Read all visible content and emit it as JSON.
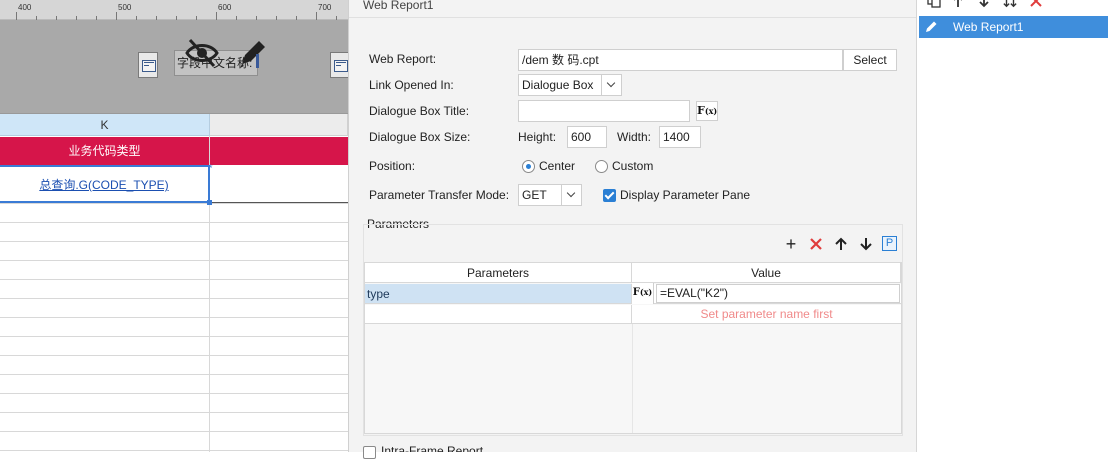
{
  "ruler": {
    "labels": [
      "400",
      "500",
      "600",
      "700"
    ]
  },
  "designer": {
    "field_label": "字段中文名称:",
    "column_header": "K",
    "header_cell": "业务代码类型",
    "selected_cell": "总查询.G(CODE_TYPE)"
  },
  "dialog": {
    "title": "Web Report1",
    "web_report_label": "Web Report:",
    "web_report_value": "/dem              数              码.cpt",
    "select_button": "Select",
    "link_opened_label": "Link Opened In:",
    "link_opened_value": "Dialogue Box",
    "dlg_title_label": "Dialogue Box Title:",
    "dlg_title_value": "",
    "dlg_size_label": "Dialogue Box Size:",
    "height_label": "Height:",
    "height_value": "600",
    "width_label": "Width:",
    "width_value": "1400",
    "position_label": "Position:",
    "position_center": "Center",
    "position_custom": "Custom",
    "position_selected": "Center",
    "transfer_label": "Parameter Transfer Mode:",
    "transfer_value": "GET",
    "display_pane_label": "Display Parameter Pane",
    "display_pane_checked": true,
    "parameters_section": "Parameters",
    "table": {
      "headers": [
        "Parameters",
        "Value"
      ],
      "rows": [
        {
          "name": "type",
          "value": "=EVAL(\"K2\")"
        },
        {
          "name": "",
          "value": "Set parameter name first"
        }
      ]
    },
    "bottom_label": "Intra-Frame Report"
  },
  "right_panel": {
    "items": [
      {
        "label": "Web Report1",
        "selected": true
      }
    ]
  },
  "colors": {
    "header_red": "#d6154a",
    "selection_blue": "#3f8edc",
    "delete_red": "#e03c3c",
    "placeholder": "#f08a8a"
  }
}
